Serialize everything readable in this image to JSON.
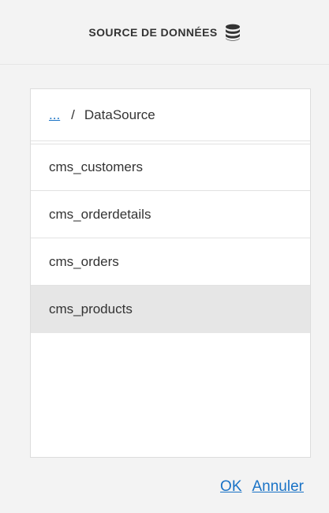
{
  "header": {
    "title": "SOURCE DE DONNÉES",
    "icon": "database-icon"
  },
  "breadcrumb": {
    "up_label": "...",
    "separator": "/",
    "current": "DataSource"
  },
  "items": [
    {
      "label": "cms_customers",
      "selected": false
    },
    {
      "label": "cms_orderdetails",
      "selected": false
    },
    {
      "label": "cms_orders",
      "selected": false
    },
    {
      "label": "cms_products",
      "selected": true
    }
  ],
  "actions": {
    "ok_label": "OK",
    "cancel_label": "Annuler"
  },
  "colors": {
    "link": "#1a73c6",
    "selected_bg": "#e6e6e6",
    "panel_bg": "#f3f3f3"
  }
}
